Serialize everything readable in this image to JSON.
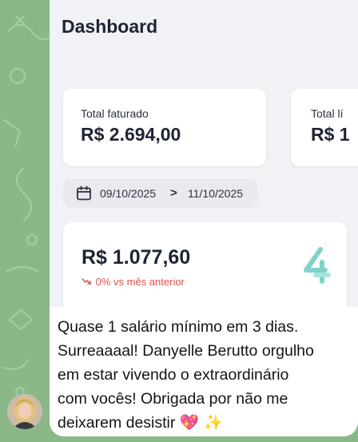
{
  "screenshot": {
    "title": "Dashboard",
    "cards": [
      {
        "label": "Total faturado",
        "value": "R$ 2.694,00"
      },
      {
        "label": "Total lí",
        "value": "R$ 1"
      }
    ],
    "date_range": {
      "start": "09/10/2025",
      "separator": ">",
      "end": "11/10/2025",
      "icon": "calendar-icon"
    },
    "highlight": {
      "value": "R$ 1.077,60",
      "trend_icon": "trend-down-icon",
      "trend_text": "0% vs mês anterior"
    },
    "brand_icon": "quatro-logo"
  },
  "message": {
    "lines": [
      "Quase 1 salário mínimo em 3 dias.",
      "Surreaaaal! Danyelle Berutto orgulho",
      "em estar vivendo o extraordinário",
      "com vocês! Obrigada por não me",
      "deixarem desistir 💖 ✨"
    ]
  },
  "colors": {
    "chat_background": "#8ab889",
    "dashboard_background": "#f1f2f5",
    "negative_trend": "#d9534f",
    "brand_accent": "#7fd3c9"
  }
}
